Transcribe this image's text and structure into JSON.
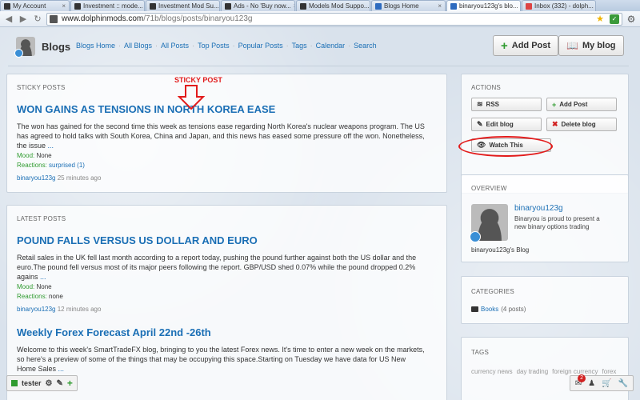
{
  "browser": {
    "tabs": [
      {
        "label": "My Account",
        "fav": "dark"
      },
      {
        "label": "Investment :: mode...",
        "fav": "dark"
      },
      {
        "label": "Investment Mod Su...",
        "fav": "dark"
      },
      {
        "label": "Ads - No 'Buy now...",
        "fav": "dark"
      },
      {
        "label": "Models Mod Suppo...",
        "fav": "dark"
      },
      {
        "label": "Blogs Home",
        "fav": "blue"
      },
      {
        "label": "binaryou123g's blo...",
        "fav": "blue",
        "active": true
      },
      {
        "label": "Inbox (332) - dolph...",
        "fav": "gm"
      }
    ],
    "url_host": "www.dolphinmods.com",
    "url_path": "/71b/blogs/posts/binaryou123g"
  },
  "header": {
    "title": "Blogs",
    "nav": [
      "Blogs Home",
      "All Blogs",
      "All Posts",
      "Top Posts",
      "Popular Posts",
      "Tags",
      "Calendar",
      "Search"
    ],
    "add_post": "Add Post",
    "my_blog": "My blog"
  },
  "annotation": {
    "text": "STICKY POST"
  },
  "sticky": {
    "heading": "STICKY POSTS",
    "title": "WON GAINS AS TENSIONS IN NORTH KOREA EASE",
    "body": "The won has gained for the second time this week as tensions ease regarding North Korea's nuclear weapons program. The US has agreed to hold talks with South Korea, China and Japan, and this news has eased some pressure off the won. Nonetheless, the issue",
    "more": "...",
    "mood_label": "Mood:",
    "mood": "None",
    "reactions_label": "Reactions:",
    "reactions": "surprised (1)",
    "author": "binaryou123g",
    "time": "25 minutes ago"
  },
  "latest": {
    "heading": "LATEST POSTS",
    "post1": {
      "title": "POUND FALLS VERSUS US DOLLAR AND EURO",
      "body": "Retail sales in the UK fell last month according to a report today, pushing the pound further against both the US dollar and the euro.The pound fell versus most of its major peers following the report. GBP/USD shed 0.07% while the pound dropped 0.2% agains",
      "more": "...",
      "mood_label": "Mood:",
      "mood": "None",
      "reactions_label": "Reactions:",
      "reactions": "none",
      "author": "binaryou123g",
      "time": "12 minutes ago"
    },
    "post2": {
      "title": "Weekly Forex Forecast April 22nd -26th",
      "body": "Welcome to this week's SmartTradeFX blog, bringing to you the latest Forex news. It's time to enter a new week on the markets, so here's a preview of some of the things that may be occupying this space.Starting on Tuesday we have data for US New Home Sales",
      "more": "..."
    }
  },
  "actions": {
    "heading": "ACTIONS",
    "rss": "RSS",
    "add_post": "Add Post",
    "edit_blog": "Edit blog",
    "delete_blog": "Delete blog",
    "watch": "Watch This"
  },
  "overview": {
    "heading": "OVERVIEW",
    "name": "binaryou123g",
    "desc": "Binaryou is proud to present a new binary options trading",
    "blog": "binaryou123g's Blog"
  },
  "categories": {
    "heading": "CATEGORIES",
    "item": "Books",
    "count": "(4 posts)"
  },
  "tags": {
    "heading": "TAGS",
    "items": [
      "currency news",
      "day trading",
      "foreign currency",
      "forex"
    ]
  },
  "bottombar": {
    "user": "tester",
    "notifications": "2"
  }
}
